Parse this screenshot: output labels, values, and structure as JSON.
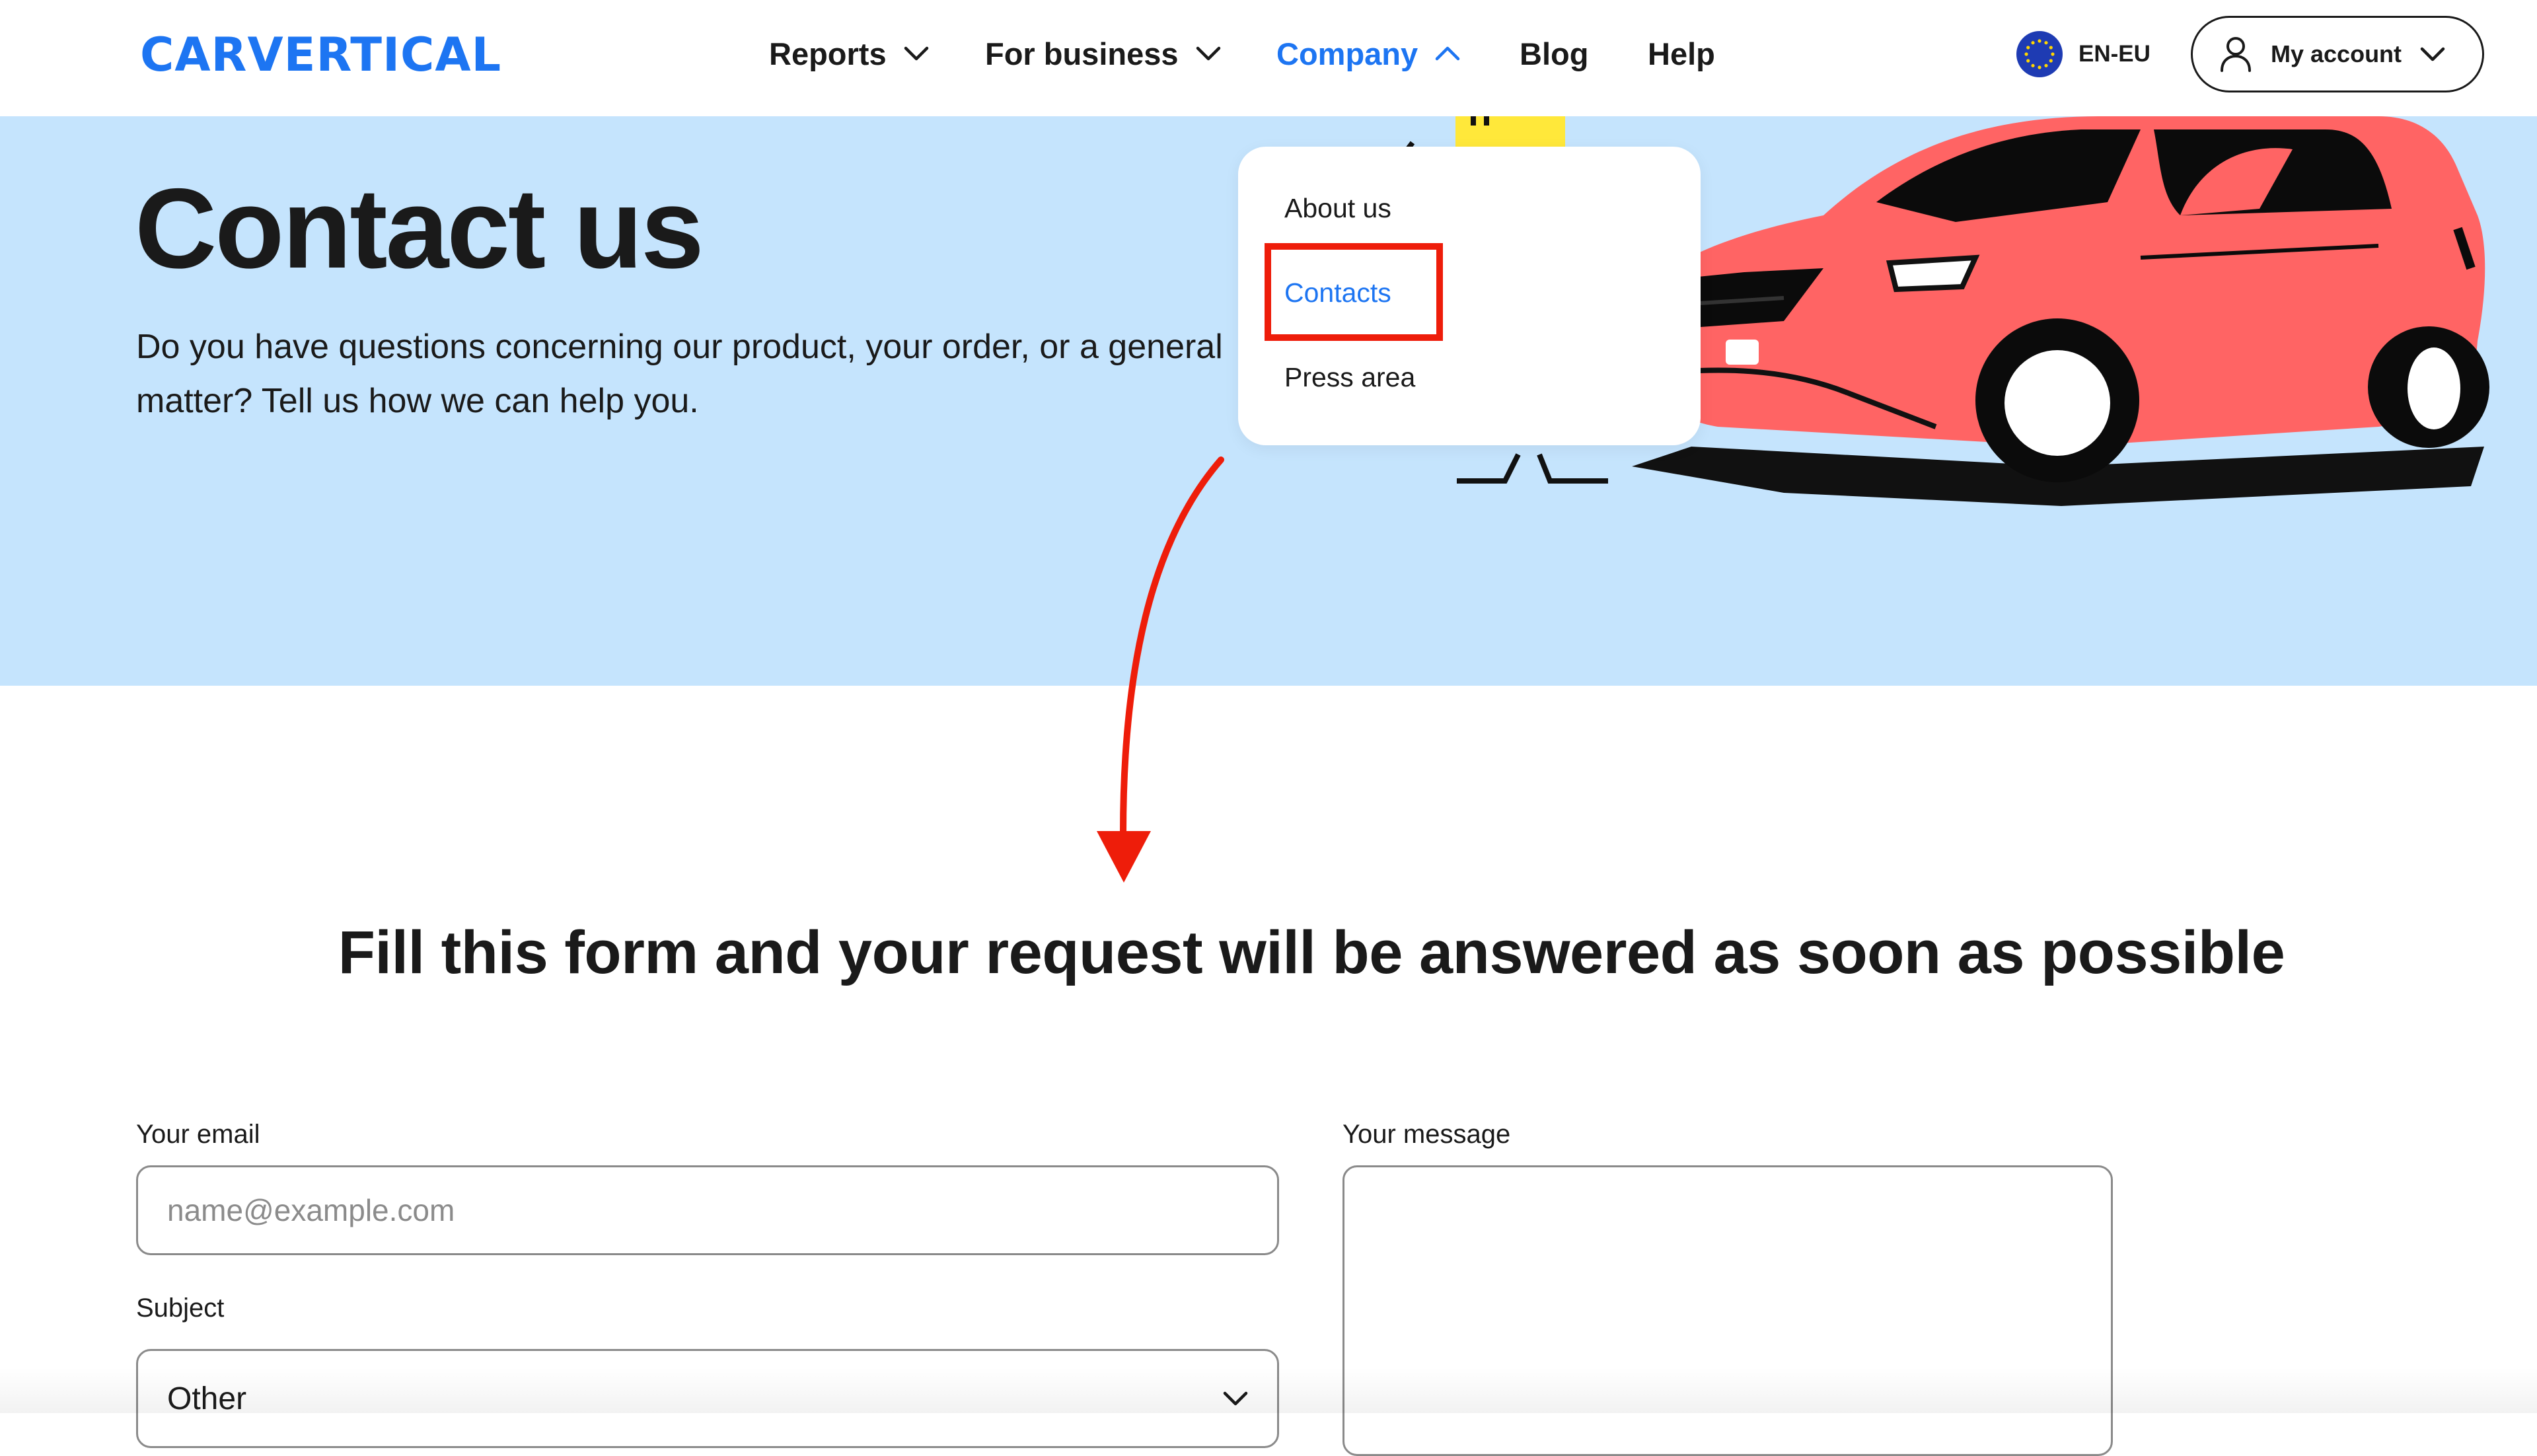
{
  "header": {
    "logo": "CARVERTICAL",
    "nav": [
      {
        "label": "Reports"
      },
      {
        "label": "For business"
      },
      {
        "label": "Company"
      },
      {
        "label": "Blog"
      },
      {
        "label": "Help"
      }
    ],
    "language": "EN-EU",
    "account_label": "My account"
  },
  "dropdown": {
    "items": [
      {
        "label": "About us"
      },
      {
        "label": "Contacts"
      },
      {
        "label": "Press area"
      }
    ]
  },
  "hero": {
    "title": "Contact us",
    "description": "Do you have questions concerning our product, your order, or a general matter? Tell us how we can help you."
  },
  "form": {
    "heading": "Fill this form and your request will be answered as soon as possible",
    "email_label": "Your email",
    "email_placeholder": "name@example.com",
    "subject_label": "Subject",
    "subject_value": "Other",
    "message_label": "Your message"
  },
  "colors": {
    "brand": "#1d75f2",
    "hero_bg": "#c5e4fd",
    "annotation": "#ee1d0a",
    "car": "#ff6464"
  }
}
